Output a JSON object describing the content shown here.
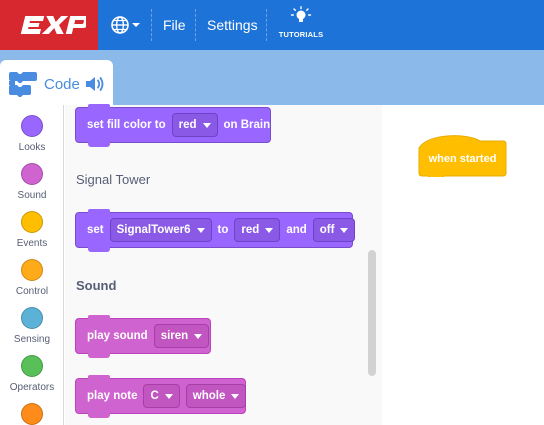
{
  "app": {
    "logo_text": "EXP",
    "colors": {
      "brand_red": "#d8282f",
      "menubar_blue": "#1e73d8",
      "tab_band": "#8ab9ea",
      "looks": "#9966ff",
      "sound": "#cf63cf",
      "events": "#ffbf00"
    }
  },
  "menubar": {
    "language_icon": "globe-icon",
    "file_label": "File",
    "settings_label": "Settings",
    "tutorials_label": "TUTORIALS",
    "tutorials_icon": "lightbulb-icon"
  },
  "tabs": {
    "code_label": "Code",
    "code_icon": "code-blocks-icon",
    "sound_icon": "speaker-icon"
  },
  "categories": [
    {
      "label": "Looks",
      "color": "#9966ff"
    },
    {
      "label": "Sound",
      "color": "#cf63cf"
    },
    {
      "label": "Events",
      "color": "#ffbf00"
    },
    {
      "label": "Control",
      "color": "#ffab19"
    },
    {
      "label": "Sensing",
      "color": "#5cb1d6"
    },
    {
      "label": "Operators",
      "color": "#59c059"
    },
    {
      "label": "",
      "color": "#ff8c1a"
    }
  ],
  "palette": {
    "fill_color_block": {
      "pre": "set fill color to",
      "value": "red",
      "post": "on Brain"
    },
    "signal_tower_title": "Signal Tower",
    "signal_tower_block": {
      "pre": "set",
      "device": "SignalTower6",
      "to": "to",
      "value1": "red",
      "and": "and",
      "value2": "off"
    },
    "sound_title": "Sound",
    "play_sound_block": {
      "pre": "play sound",
      "value": "siren"
    },
    "play_note_block": {
      "pre": "play note",
      "note": "C",
      "duration": "whole"
    }
  },
  "workspace": {
    "hat_block_label": "when started"
  }
}
